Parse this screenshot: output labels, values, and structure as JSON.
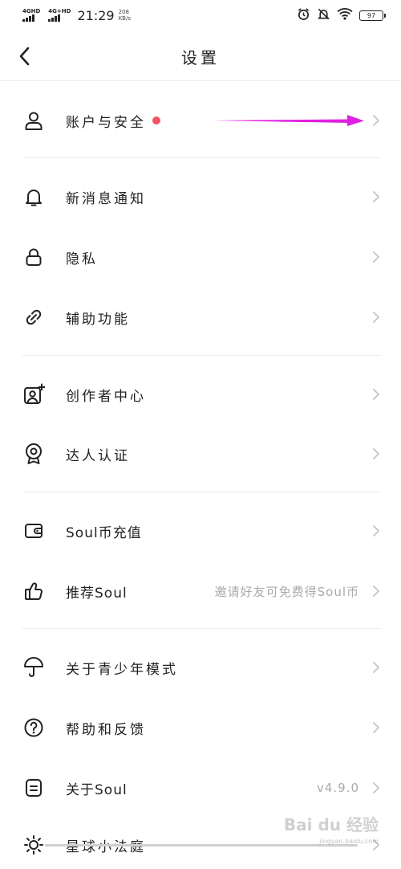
{
  "status_bar": {
    "sim1": "4GHD",
    "sim2": "4G+HD",
    "time": "21:29",
    "speed_value": "208",
    "speed_unit": "KB/s",
    "battery": "97"
  },
  "header": {
    "title": "设置"
  },
  "menu": {
    "account_security": {
      "label": "账户与安全",
      "icon": "person-icon"
    },
    "notifications": {
      "label": "新消息通知",
      "icon": "bell-icon"
    },
    "privacy": {
      "label": "隐私",
      "icon": "lock-icon"
    },
    "accessibility": {
      "label": "辅助功能",
      "icon": "link-icon"
    },
    "creator_center": {
      "label": "创作者中心",
      "icon": "creator-portrait-icon"
    },
    "verification": {
      "label": "达人认证",
      "icon": "badge-icon"
    },
    "soul_coin": {
      "label": "Soul币充值",
      "icon": "wallet-icon"
    },
    "recommend": {
      "label": "推荐Soul",
      "value": "邀请好友可免费得Soul币",
      "icon": "thumbs-up-icon"
    },
    "youth_mode": {
      "label": "关于青少年模式",
      "icon": "umbrella-icon"
    },
    "help": {
      "label": "帮助和反馈",
      "icon": "help-icon"
    },
    "about": {
      "label": "关于Soul",
      "value": "v4.9.0",
      "icon": "document-icon"
    },
    "planet_court": {
      "label": "星球小法庭",
      "icon": "sun-icon"
    }
  },
  "colors": {
    "accent_dot": "#f05566",
    "annotation_arrow": "#e020e0",
    "secondary_text": "#aaaaaa"
  },
  "watermark": {
    "brand": "Bai du 经验",
    "url": "jingyan.baidu.com"
  }
}
